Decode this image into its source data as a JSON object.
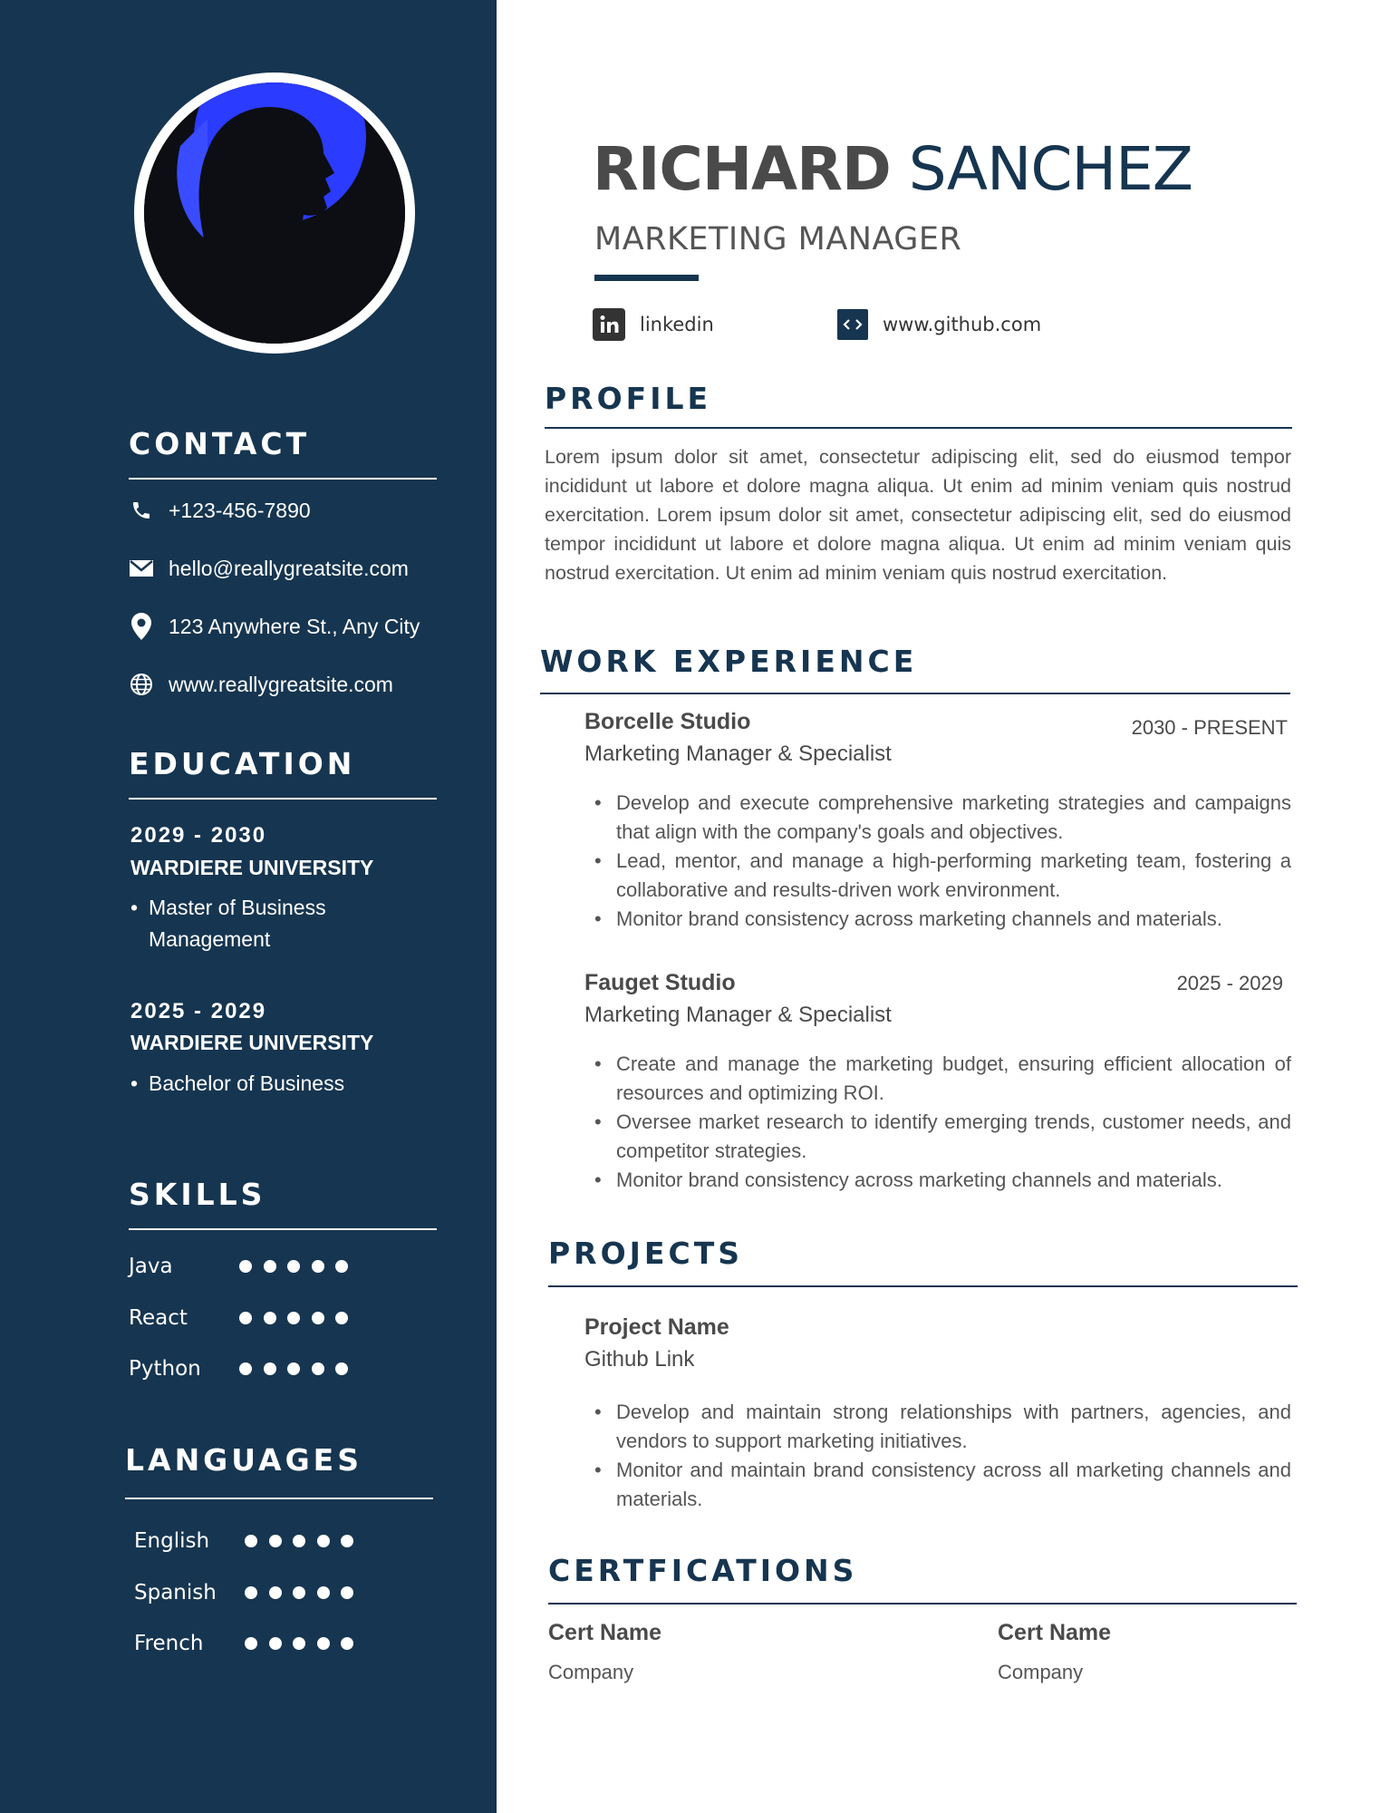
{
  "colors": {
    "sidebar": "#163550",
    "accent": "#163550",
    "photo_glow": "#2b3bff",
    "text": "#4a4a4a"
  },
  "header": {
    "first_name": "RICHARD",
    "last_name": "SANCHEZ",
    "title": "MARKETING MANAGER",
    "links": [
      {
        "icon": "linkedin-icon",
        "label": "linkedin"
      },
      {
        "icon": "code-icon",
        "label": "www.github.com"
      }
    ]
  },
  "contact": {
    "heading": "CONTACT",
    "items": [
      {
        "icon": "phone-icon",
        "text": "+123-456-7890"
      },
      {
        "icon": "mail-icon",
        "text": "hello@reallygreatsite.com"
      },
      {
        "icon": "location-pin-icon",
        "text": "123 Anywhere St., Any City"
      },
      {
        "icon": "globe-icon",
        "text": "www.reallygreatsite.com"
      }
    ]
  },
  "education": {
    "heading": "EDUCATION",
    "items": [
      {
        "years": "2029 - 2030",
        "university": "WARDIERE UNIVERSITY",
        "degree": "Master of Business Management"
      },
      {
        "years": "2025 - 2029",
        "university": "WARDIERE UNIVERSITY",
        "degree": "Bachelor of Business"
      }
    ]
  },
  "skills": {
    "heading": "SKILLS",
    "items": [
      {
        "name": "Java",
        "level": 5
      },
      {
        "name": "React",
        "level": 5
      },
      {
        "name": "Python",
        "level": 5
      }
    ]
  },
  "languages": {
    "heading": "LANGUAGES",
    "items": [
      {
        "name": "English",
        "level": 5
      },
      {
        "name": "Spanish",
        "level": 5
      },
      {
        "name": "French",
        "level": 5
      }
    ]
  },
  "profile": {
    "heading": "PROFILE",
    "text": "Lorem ipsum dolor sit amet, consectetur adipiscing elit, sed do eiusmod tempor incididunt ut labore et dolore magna aliqua. Ut enim ad minim veniam quis nostrud exercitation. Lorem ipsum dolor sit amet, consectetur adipiscing elit, sed do eiusmod tempor incididunt ut labore et dolore magna aliqua. Ut enim ad minim veniam quis nostrud exercitation. Ut enim ad minim veniam quis nostrud exercitation."
  },
  "work": {
    "heading": "WORK EXPERIENCE",
    "jobs": [
      {
        "company": "Borcelle Studio",
        "role": "Marketing Manager & Specialist",
        "period": "2030 - PRESENT",
        "bullets": [
          "Develop and execute comprehensive marketing strategies and campaigns that align with the company's goals and objectives.",
          "Lead, mentor, and manage a high-performing marketing team, fostering a collaborative and results-driven work environment.",
          "Monitor brand consistency across marketing channels and materials."
        ]
      },
      {
        "company": "Fauget Studio",
        "role": "Marketing Manager & Specialist",
        "period": "2025 -  2029",
        "bullets": [
          "Create and manage the marketing budget, ensuring efficient allocation of resources and optimizing ROI.",
          "Oversee market research to identify emerging trends, customer needs, and competitor strategies.",
          "Monitor brand consistency across marketing channels and materials."
        ]
      }
    ]
  },
  "projects": {
    "heading": "PROJECTS",
    "items": [
      {
        "name": "Project Name",
        "link": "Github Link",
        "bullets": [
          "Develop and maintain strong relationships with partners, agencies, and vendors to support marketing initiatives.",
          "Monitor and maintain brand consistency across all marketing channels and materials."
        ]
      }
    ]
  },
  "certifications": {
    "heading": "CERTFICATIONS",
    "items": [
      {
        "name": "Cert Name",
        "company": "Company"
      },
      {
        "name": "Cert Name",
        "company": "Company"
      }
    ]
  }
}
